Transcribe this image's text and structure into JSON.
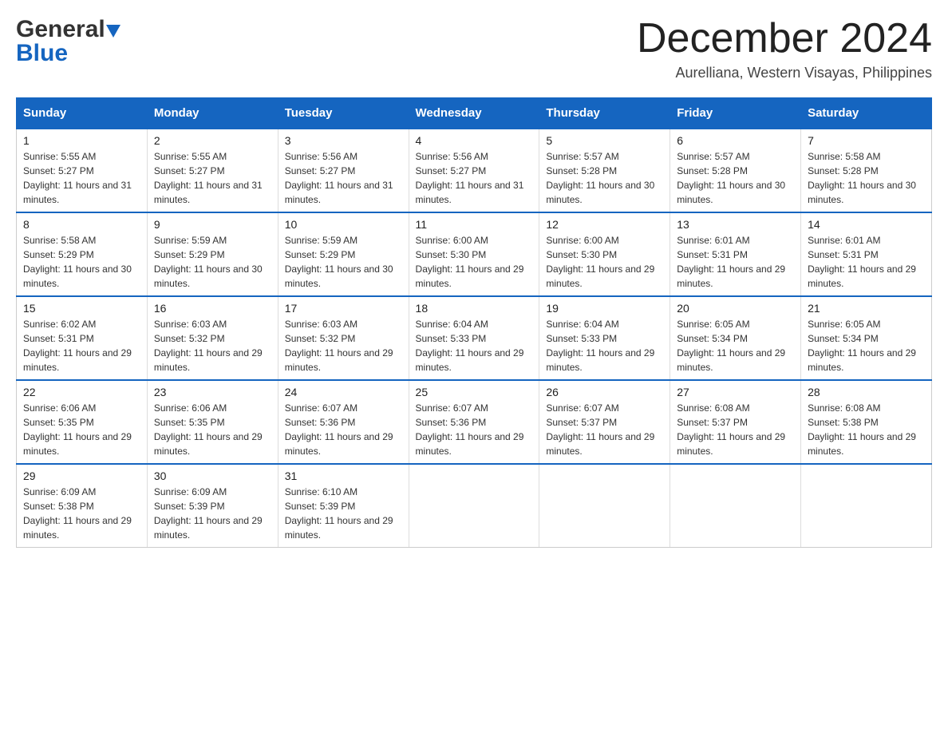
{
  "header": {
    "logo_general": "General",
    "logo_blue": "Blue",
    "month_title": "December 2024",
    "subtitle": "Aurelliana, Western Visayas, Philippines"
  },
  "weekdays": [
    "Sunday",
    "Monday",
    "Tuesday",
    "Wednesday",
    "Thursday",
    "Friday",
    "Saturday"
  ],
  "weeks": [
    [
      {
        "day": "1",
        "sunrise": "5:55 AM",
        "sunset": "5:27 PM",
        "daylight": "11 hours and 31 minutes."
      },
      {
        "day": "2",
        "sunrise": "5:55 AM",
        "sunset": "5:27 PM",
        "daylight": "11 hours and 31 minutes."
      },
      {
        "day": "3",
        "sunrise": "5:56 AM",
        "sunset": "5:27 PM",
        "daylight": "11 hours and 31 minutes."
      },
      {
        "day": "4",
        "sunrise": "5:56 AM",
        "sunset": "5:27 PM",
        "daylight": "11 hours and 31 minutes."
      },
      {
        "day": "5",
        "sunrise": "5:57 AM",
        "sunset": "5:28 PM",
        "daylight": "11 hours and 30 minutes."
      },
      {
        "day": "6",
        "sunrise": "5:57 AM",
        "sunset": "5:28 PM",
        "daylight": "11 hours and 30 minutes."
      },
      {
        "day": "7",
        "sunrise": "5:58 AM",
        "sunset": "5:28 PM",
        "daylight": "11 hours and 30 minutes."
      }
    ],
    [
      {
        "day": "8",
        "sunrise": "5:58 AM",
        "sunset": "5:29 PM",
        "daylight": "11 hours and 30 minutes."
      },
      {
        "day": "9",
        "sunrise": "5:59 AM",
        "sunset": "5:29 PM",
        "daylight": "11 hours and 30 minutes."
      },
      {
        "day": "10",
        "sunrise": "5:59 AM",
        "sunset": "5:29 PM",
        "daylight": "11 hours and 30 minutes."
      },
      {
        "day": "11",
        "sunrise": "6:00 AM",
        "sunset": "5:30 PM",
        "daylight": "11 hours and 29 minutes."
      },
      {
        "day": "12",
        "sunrise": "6:00 AM",
        "sunset": "5:30 PM",
        "daylight": "11 hours and 29 minutes."
      },
      {
        "day": "13",
        "sunrise": "6:01 AM",
        "sunset": "5:31 PM",
        "daylight": "11 hours and 29 minutes."
      },
      {
        "day": "14",
        "sunrise": "6:01 AM",
        "sunset": "5:31 PM",
        "daylight": "11 hours and 29 minutes."
      }
    ],
    [
      {
        "day": "15",
        "sunrise": "6:02 AM",
        "sunset": "5:31 PM",
        "daylight": "11 hours and 29 minutes."
      },
      {
        "day": "16",
        "sunrise": "6:03 AM",
        "sunset": "5:32 PM",
        "daylight": "11 hours and 29 minutes."
      },
      {
        "day": "17",
        "sunrise": "6:03 AM",
        "sunset": "5:32 PM",
        "daylight": "11 hours and 29 minutes."
      },
      {
        "day": "18",
        "sunrise": "6:04 AM",
        "sunset": "5:33 PM",
        "daylight": "11 hours and 29 minutes."
      },
      {
        "day": "19",
        "sunrise": "6:04 AM",
        "sunset": "5:33 PM",
        "daylight": "11 hours and 29 minutes."
      },
      {
        "day": "20",
        "sunrise": "6:05 AM",
        "sunset": "5:34 PM",
        "daylight": "11 hours and 29 minutes."
      },
      {
        "day": "21",
        "sunrise": "6:05 AM",
        "sunset": "5:34 PM",
        "daylight": "11 hours and 29 minutes."
      }
    ],
    [
      {
        "day": "22",
        "sunrise": "6:06 AM",
        "sunset": "5:35 PM",
        "daylight": "11 hours and 29 minutes."
      },
      {
        "day": "23",
        "sunrise": "6:06 AM",
        "sunset": "5:35 PM",
        "daylight": "11 hours and 29 minutes."
      },
      {
        "day": "24",
        "sunrise": "6:07 AM",
        "sunset": "5:36 PM",
        "daylight": "11 hours and 29 minutes."
      },
      {
        "day": "25",
        "sunrise": "6:07 AM",
        "sunset": "5:36 PM",
        "daylight": "11 hours and 29 minutes."
      },
      {
        "day": "26",
        "sunrise": "6:07 AM",
        "sunset": "5:37 PM",
        "daylight": "11 hours and 29 minutes."
      },
      {
        "day": "27",
        "sunrise": "6:08 AM",
        "sunset": "5:37 PM",
        "daylight": "11 hours and 29 minutes."
      },
      {
        "day": "28",
        "sunrise": "6:08 AM",
        "sunset": "5:38 PM",
        "daylight": "11 hours and 29 minutes."
      }
    ],
    [
      {
        "day": "29",
        "sunrise": "6:09 AM",
        "sunset": "5:38 PM",
        "daylight": "11 hours and 29 minutes."
      },
      {
        "day": "30",
        "sunrise": "6:09 AM",
        "sunset": "5:39 PM",
        "daylight": "11 hours and 29 minutes."
      },
      {
        "day": "31",
        "sunrise": "6:10 AM",
        "sunset": "5:39 PM",
        "daylight": "11 hours and 29 minutes."
      },
      null,
      null,
      null,
      null
    ]
  ],
  "labels": {
    "sunrise_prefix": "Sunrise: ",
    "sunset_prefix": "Sunset: ",
    "daylight_prefix": "Daylight: "
  }
}
